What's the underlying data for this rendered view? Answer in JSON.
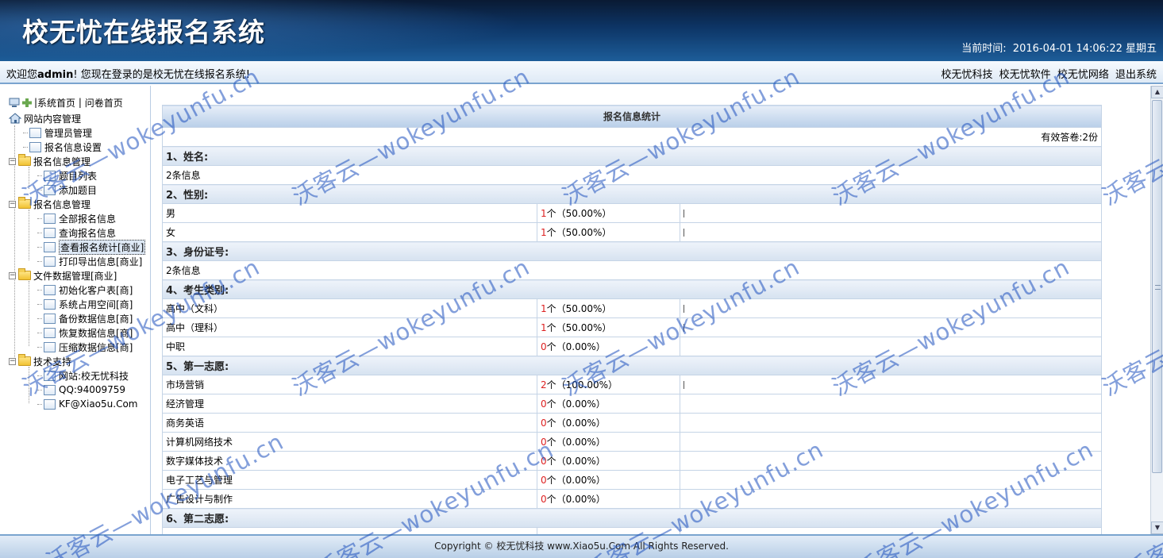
{
  "header": {
    "title": "校无忧在线报名系统",
    "clock_label": "当前时间:",
    "clock_value": "2016-04-01 14:06:22 星期五"
  },
  "welcome": {
    "prefix": "欢迎您",
    "user": "admin",
    "suffix": "! 您现在登录的是校无忧在线报名系统!",
    "links": [
      "校无忧科技",
      "校无忧软件",
      "校无忧网络",
      "退出系统"
    ]
  },
  "sidebar": {
    "top_links": [
      "系统首页",
      "问卷首页"
    ],
    "tree": [
      {
        "label": "网站内容管理",
        "type": "home",
        "level": 0
      },
      {
        "label": "管理员管理",
        "type": "page",
        "level": 1
      },
      {
        "label": "报名信息设置",
        "type": "page",
        "level": 1
      },
      {
        "label": "报名信息管理",
        "type": "folder",
        "level": 0
      },
      {
        "label": "题目列表",
        "type": "page",
        "level": 2
      },
      {
        "label": "添加题目",
        "type": "page",
        "level": 2
      },
      {
        "label": "报名信息管理",
        "type": "folder",
        "level": 0
      },
      {
        "label": "全部报名信息",
        "type": "page",
        "level": 2
      },
      {
        "label": "查询报名信息",
        "type": "page",
        "level": 2
      },
      {
        "label": "查看报名统计[商业]",
        "type": "page",
        "level": 2,
        "selected": true
      },
      {
        "label": "打印导出信息[商业]",
        "type": "page",
        "level": 2
      },
      {
        "label": "文件数据管理[商业]",
        "type": "folder",
        "level": 0
      },
      {
        "label": "初始化客户表[商]",
        "type": "page",
        "level": 2
      },
      {
        "label": "系统占用空间[商]",
        "type": "page",
        "level": 2
      },
      {
        "label": "备份数据信息[商]",
        "type": "page",
        "level": 2
      },
      {
        "label": "恢复数据信息[商]",
        "type": "page",
        "level": 2
      },
      {
        "label": "压缩数据信息[商]",
        "type": "page",
        "level": 2
      },
      {
        "label": "技术支持",
        "type": "folder",
        "level": 0
      },
      {
        "label": "网站:校无忧科技",
        "type": "page",
        "level": 2
      },
      {
        "label": "QQ:94009759",
        "type": "page",
        "level": 2
      },
      {
        "label": "KF@Xiao5u.Com",
        "type": "page",
        "level": 2
      }
    ]
  },
  "stats": {
    "title": "报名信息统计",
    "count_label": "有效答卷:2份",
    "sections": [
      {
        "heading": "1、姓名:",
        "text": "2条信息"
      },
      {
        "heading": "2、性别:",
        "rows": [
          {
            "option": "男",
            "count": "1",
            "pct": "个（50.00%）",
            "bar": true
          },
          {
            "option": "女",
            "count": "1",
            "pct": "个（50.00%）",
            "bar": true
          }
        ]
      },
      {
        "heading": "3、身份证号:",
        "text": "2条信息"
      },
      {
        "heading": "4、考生类别:",
        "rows": [
          {
            "option": "高中（文科）",
            "count": "1",
            "pct": "个（50.00%）",
            "bar": true
          },
          {
            "option": "高中（理科）",
            "count": "1",
            "pct": "个（50.00%）",
            "bar": true
          },
          {
            "option": "中职",
            "count": "0",
            "pct": "个（0.00%）",
            "bar": false
          }
        ]
      },
      {
        "heading": "5、第一志愿:",
        "rows": [
          {
            "option": "市场营销",
            "count": "2",
            "pct": "个（100.00%）",
            "bar": true
          },
          {
            "option": "经济管理",
            "count": "0",
            "pct": "个（0.00%）",
            "bar": false
          },
          {
            "option": "商务英语",
            "count": "0",
            "pct": "个（0.00%）",
            "bar": false
          },
          {
            "option": "计算机网络技术",
            "count": "0",
            "pct": "个（0.00%）",
            "bar": false
          },
          {
            "option": "数字媒体技术",
            "count": "0",
            "pct": "个（0.00%）",
            "bar": false
          },
          {
            "option": "电子工艺与管理",
            "count": "0",
            "pct": "个（0.00%）",
            "bar": false
          },
          {
            "option": "广告设计与制作",
            "count": "0",
            "pct": "个（0.00%）",
            "bar": false
          }
        ]
      },
      {
        "heading": "6、第二志愿:",
        "rows": []
      }
    ]
  },
  "footer": {
    "text": "Copyright © 校无忧科技 www.Xiao5u.Com All Rights Reserved."
  },
  "watermark": {
    "text": "沃客云—wokeyunfu.cn"
  },
  "colors": {
    "header_dark": "#0a1a33",
    "header_light": "#1d5d99",
    "accent_border": "#7aa4cf",
    "count_red": "#dd2222",
    "watermark_blue": "#1e50be"
  }
}
